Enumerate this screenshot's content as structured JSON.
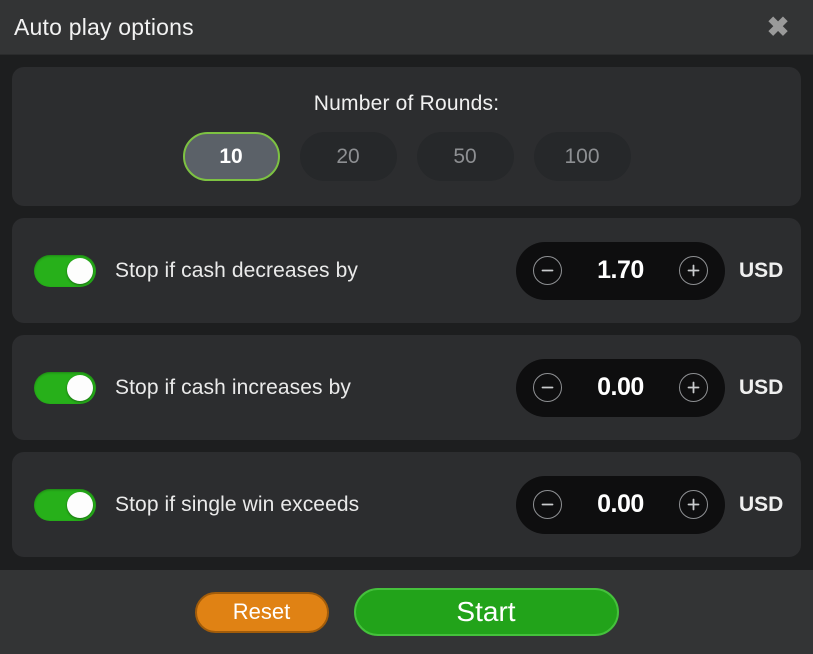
{
  "header": {
    "title": "Auto play options",
    "close_icon": "close-icon"
  },
  "rounds": {
    "title": "Number of Rounds:",
    "options": [
      {
        "label": "10",
        "selected": true
      },
      {
        "label": "20",
        "selected": false
      },
      {
        "label": "50",
        "selected": false
      },
      {
        "label": "100",
        "selected": false
      }
    ]
  },
  "stop_conditions": [
    {
      "label": "Stop if cash decreases by",
      "enabled": true,
      "value": "1.70",
      "currency": "USD",
      "minus_icon": "minus-icon",
      "plus_icon": "plus-icon"
    },
    {
      "label": "Stop if cash increases by",
      "enabled": true,
      "value": "0.00",
      "currency": "USD",
      "minus_icon": "minus-icon",
      "plus_icon": "plus-icon"
    },
    {
      "label": "Stop if single win exceeds",
      "enabled": true,
      "value": "0.00",
      "currency": "USD",
      "minus_icon": "minus-icon",
      "plus_icon": "plus-icon"
    }
  ],
  "footer": {
    "reset_label": "Reset",
    "start_label": "Start"
  },
  "colors": {
    "accent_green": "#27b01a",
    "start_green": "#22a31a",
    "reset_orange": "#e08214",
    "selected_outline": "#7dc242",
    "header_bg": "#333435",
    "panel_bg": "#2c2d2f",
    "body_bg": "#1d1e1f"
  }
}
